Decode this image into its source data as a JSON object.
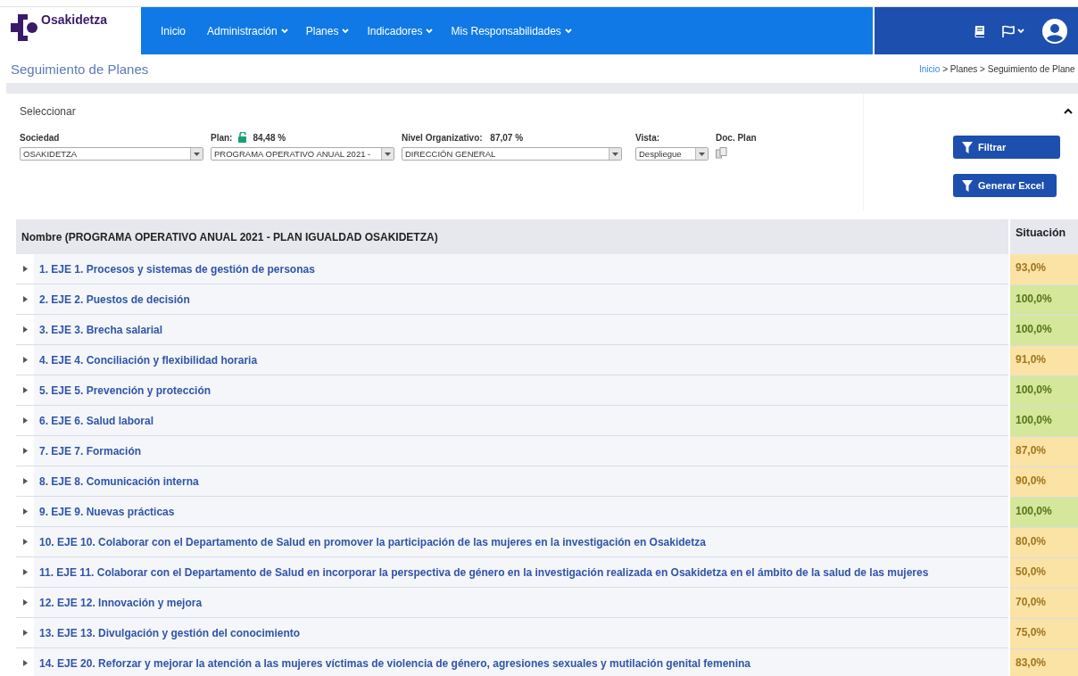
{
  "header": {
    "brand": "Osakidetza",
    "nav": [
      {
        "label": "Inicio",
        "dropdown": false
      },
      {
        "label": "Administración",
        "dropdown": true
      },
      {
        "label": "Planes",
        "dropdown": true
      },
      {
        "label": "Indicadores",
        "dropdown": true
      },
      {
        "label": "Mis Responsabilidades",
        "dropdown": true
      }
    ]
  },
  "page_title": "Seguimiento de Planes",
  "breadcrumb": {
    "link": "Inicio",
    "rest": "> Planes > Seguimiento de Plane"
  },
  "filters": {
    "title": "Seleccionar",
    "expanded": true,
    "sociedad": {
      "label": "Sociedad",
      "value": "OSAKIDETZA"
    },
    "plan": {
      "label": "Plan:",
      "percent": "84,48 %",
      "value": "PROGRAMA OPERATIVO ANUAL 2021 -"
    },
    "nivel": {
      "label": "Nivel Organizativo:",
      "percent": "87,07 %",
      "value": "DIRECCIÓN GENERAL"
    },
    "vista": {
      "label": "Vista:",
      "value": "Despliegue"
    },
    "doc": {
      "label": "Doc. Plan"
    },
    "buttons": [
      "Filtrar",
      "Generar Excel"
    ]
  },
  "table": {
    "columns": [
      "Nombre (PROGRAMA OPERATIVO ANUAL 2021 - PLAN IGUALDAD OSAKIDETZA)",
      "Situación"
    ],
    "rows": [
      {
        "name": "1. EJE 1. Procesos y sistemas de gestión de personas",
        "situacion": "93,0%",
        "color": "#fbe3a6",
        "expanded": false
      },
      {
        "name": "2. EJE 2. Puestos de decisión",
        "situacion": "100,0%",
        "color": "#d5e79b",
        "expanded": false
      },
      {
        "name": "3. EJE 3. Brecha salarial",
        "situacion": "100,0%",
        "color": "#d5e79b",
        "expanded": false
      },
      {
        "name": "4. EJE 4. Conciliación y flexibilidad horaria",
        "situacion": "91,0%",
        "color": "#fbe3a6",
        "expanded": false
      },
      {
        "name": "5. EJE 5. Prevención y protección",
        "situacion": "100,0%",
        "color": "#d5e79b",
        "expanded": false
      },
      {
        "name": "6. EJE 6. Salud laboral",
        "situacion": "100,0%",
        "color": "#d5e79b",
        "expanded": false
      },
      {
        "name": "7. EJE 7. Formación",
        "situacion": "87,0%",
        "color": "#fbe3a6",
        "expanded": false
      },
      {
        "name": "8. EJE 8. Comunicación interna",
        "situacion": "90,0%",
        "color": "#fbe3a6",
        "expanded": false
      },
      {
        "name": "9. EJE 9. Nuevas prácticas",
        "situacion": "100,0%",
        "color": "#d5e79b",
        "expanded": false
      },
      {
        "name": "10. EJE 10. Colaborar con el Departamento de Salud en promover la participación de las mujeres en la investigación en Osakidetza",
        "situacion": "80,0%",
        "color": "#fbe3a6",
        "expanded": false
      },
      {
        "name": "11. EJE 11. Colaborar con el Departamento de Salud en incorporar la perspectiva de género en la investigación realizada en Osakidetza en el ámbito de la salud de las mujeres",
        "situacion": "50,0%",
        "color": "#fbe3a6",
        "expanded": false
      },
      {
        "name": "12. EJE 12. Innovación y mejora",
        "situacion": "70,0%",
        "color": "#fbe3a6",
        "expanded": false
      },
      {
        "name": "13. EJE 13. Divulgación y gestión del conocimiento",
        "situacion": "75,0%",
        "color": "#fbe3a6",
        "expanded": false
      },
      {
        "name": "14. EJE 20. Reforzar y mejorar la atención a las mujeres víctimas de violencia de género, agresiones sexuales y mutilación genital femenina",
        "situacion": "83,0%",
        "color": "#fbe3a6",
        "expanded": false
      }
    ]
  }
}
